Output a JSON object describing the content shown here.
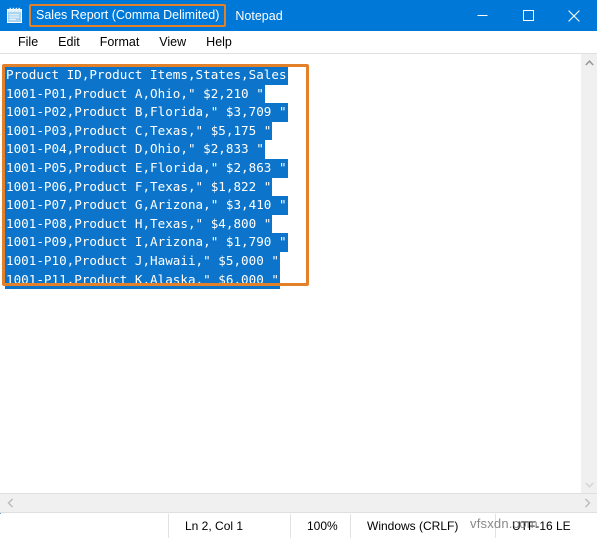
{
  "window": {
    "title_document": "Sales Report (Comma Delimited)",
    "title_app": "Notepad",
    "app_icon": "notepad-icon",
    "titlebar_color": "#0078d7",
    "annotation_color": "#e3802a",
    "selection_color": "#0c74ca"
  },
  "controls": {
    "minimize": "minimize-icon",
    "maximize": "maximize-icon",
    "close": "close-icon"
  },
  "menubar": {
    "items": [
      {
        "label": "File"
      },
      {
        "label": "Edit"
      },
      {
        "label": "Format"
      },
      {
        "label": "View"
      },
      {
        "label": "Help"
      }
    ]
  },
  "document": {
    "lines": [
      "Product ID,Product Items,States,Sales",
      "1001-P01,Product A,Ohio,\" $2,210 \"",
      "1001-P02,Product B,Florida,\" $3,709 \"",
      "1001-P03,Product C,Texas,\" $5,175 \"",
      "1001-P04,Product D,Ohio,\" $2,833 \"",
      "1001-P05,Product E,Florida,\" $2,863 \"",
      "1001-P06,Product F,Texas,\" $1,822 \"",
      "1001-P07,Product G,Arizona,\" $3,410 \"",
      "1001-P08,Product H,Texas,\" $4,800 \"",
      "1001-P09,Product I,Arizona,\" $1,790 \"",
      "1001-P10,Product J,Hawaii,\" $5,000 \"",
      "1001-P11,Product K,Alaska,\" $6,000 \""
    ]
  },
  "scrollbars": {
    "vertical_up": "chevron-up-icon",
    "vertical_down": "chevron-down-icon",
    "horizontal_left": "chevron-left-icon",
    "horizontal_right": "chevron-right-icon"
  },
  "statusbar": {
    "position": "Ln 2, Col 1",
    "zoom": "100%",
    "line_ending": "Windows (CRLF)",
    "encoding": "UTF-16 LE"
  },
  "watermark": {
    "text": "vfsxdn.com"
  }
}
